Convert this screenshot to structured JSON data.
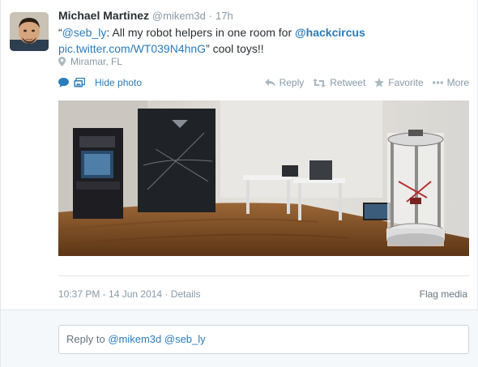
{
  "tweet": {
    "author": {
      "fullname": "Michael Martinez",
      "username": "@mikem3d",
      "avatar_icon": "user-avatar"
    },
    "separator": "·",
    "time": "17h",
    "text": {
      "mention": "@seb_ly",
      "part1": ": All my robot helpers in one room for ",
      "mention2": "@hackcircus",
      "link": "pic.twitter.com/WT039N4hnG",
      "part2": "” cool toys!!",
      "open_quote": "“"
    },
    "location": {
      "icon": "location-pin-icon",
      "label": "Miramar, FL"
    },
    "media_controls": {
      "hide_photo_label": "Hide photo",
      "icons": [
        "comment-icon",
        "photo-icon"
      ]
    },
    "actions": {
      "reply": "Reply",
      "retweet": "Retweet",
      "favorite": "Favorite",
      "more": "More"
    },
    "meta": {
      "timestamp": "10:37 PM - 14 Jun 2014",
      "separator": "·",
      "details": "Details",
      "flag": "Flag media"
    },
    "reply_box": {
      "prefix": "Reply to ",
      "mention1": "@mikem3d",
      "mention2": "@seb_ly"
    }
  },
  "colors": {
    "link_blue": "#2b7bb9",
    "muted_gray": "#8899a6",
    "text": "#292f33",
    "border": "#e1e8ed"
  }
}
